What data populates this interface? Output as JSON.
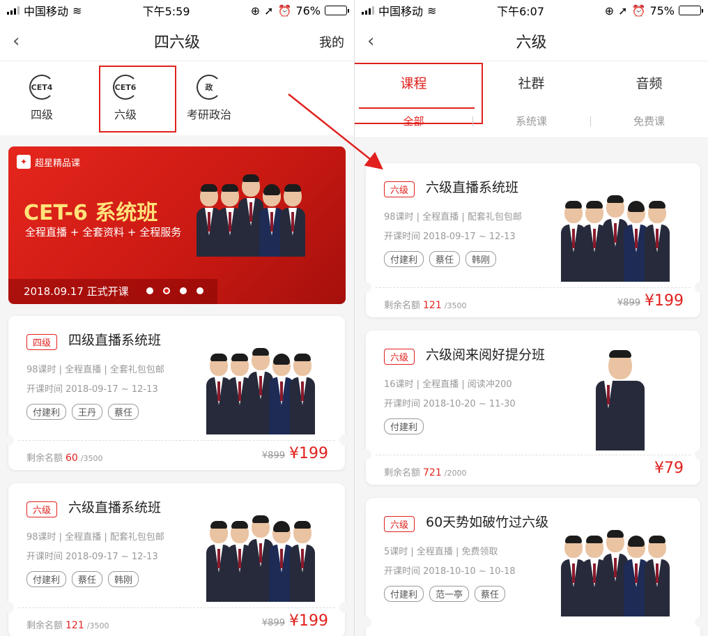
{
  "left": {
    "status": {
      "carrier": "中国移动",
      "time": "下午5:59",
      "battery": "76%",
      "battery_level": 0.76
    },
    "nav": {
      "title": "四六级",
      "mine": "我的"
    },
    "categories": [
      {
        "icon": "cet4-icon",
        "glyph": "CET4",
        "label": "四级"
      },
      {
        "icon": "cet6-icon",
        "glyph": "CET6",
        "label": "六级"
      },
      {
        "icon": "politics-icon",
        "glyph": "政",
        "label": "考研政治"
      }
    ],
    "banner": {
      "badge": "超星精品课",
      "headline": "CET-6 系统班",
      "sub": "全程直播 + 全套资料 + 全程服务",
      "footer": "2018.09.17 正式开课"
    },
    "cards": [
      {
        "tag": "四级",
        "title": "四级直播系统班",
        "meta": "98课时 | 全程直播 | 全套礼包包邮",
        "date": "开课时间 2018-09-17 ~ 12-13",
        "teachers": [
          "付建利",
          "王丹",
          "蔡任"
        ],
        "remaining_label": "剩余名额",
        "remaining": "60",
        "total": "/3500",
        "old_price": "¥899",
        "price": "¥199"
      },
      {
        "tag": "六级",
        "title": "六级直播系统班",
        "meta": "98课时 | 全程直播 | 配套礼包包邮",
        "date": "开课时间 2018-09-17 ~ 12-13",
        "teachers": [
          "付建利",
          "蔡任",
          "韩刚"
        ],
        "remaining_label": "剩余名额",
        "remaining": "121",
        "total": "/3500",
        "old_price": "¥899",
        "price": "¥199"
      }
    ]
  },
  "right": {
    "status": {
      "carrier": "中国移动",
      "time": "下午6:07",
      "battery": "75%",
      "battery_level": 0.75
    },
    "nav": {
      "title": "六级"
    },
    "tabs": [
      "课程",
      "社群",
      "音频"
    ],
    "subtabs": [
      "全部",
      "系统课",
      "免费课"
    ],
    "cards": [
      {
        "tag": "六级",
        "title": "六级直播系统班",
        "meta": "98课时 | 全程直播 | 配套礼包包邮",
        "date": "开课时间 2018-09-17 ~ 12-13",
        "teachers": [
          "付建利",
          "蔡任",
          "韩刚"
        ],
        "remaining_label": "剩余名额",
        "remaining": "121",
        "total": "/3500",
        "old_price": "¥899",
        "price": "¥199"
      },
      {
        "tag": "六级",
        "title": "六级阅来阅好提分班",
        "meta": "16课时 | 全程直播 | 阅读冲200",
        "date": "开课时间 2018-10-20 ~ 11-30",
        "teachers": [
          "付建利"
        ],
        "remaining_label": "剩余名额",
        "remaining": "721",
        "total": "/2000",
        "old_price": "",
        "price": "¥79"
      },
      {
        "tag": "六级",
        "title": "60天势如破竹过六级",
        "meta": "5课时 | 全程直播 | 免费领取",
        "date": "开课时间 2018-10-10 ~ 10-18",
        "teachers": [
          "付建利",
          "范一亭",
          "蔡任"
        ],
        "remaining_label": "",
        "remaining": "",
        "total": "",
        "old_price": "",
        "price": ""
      }
    ]
  },
  "colors": {
    "accent": "#e0211d",
    "banner": "#d41b15",
    "price": "#e0211d"
  }
}
